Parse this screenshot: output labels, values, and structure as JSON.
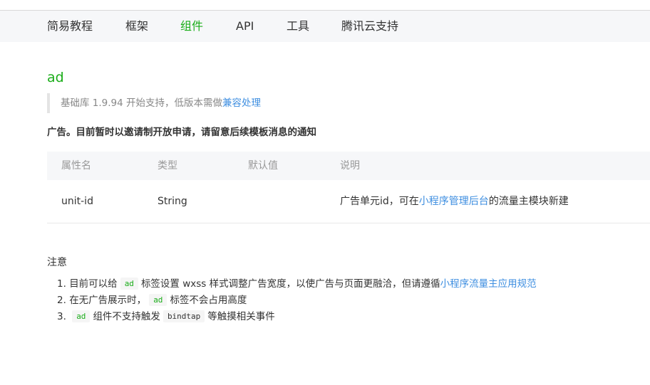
{
  "nav": {
    "items": [
      {
        "label": "简易教程",
        "active": false
      },
      {
        "label": "框架",
        "active": false
      },
      {
        "label": "组件",
        "active": true
      },
      {
        "label": "API",
        "active": false
      },
      {
        "label": "工具",
        "active": false
      },
      {
        "label": "腾讯云支持",
        "active": false
      }
    ],
    "active_color": "#1aad19"
  },
  "page": {
    "title": "ad",
    "support_text": "基础库 1.9.94 开始支持，低版本需做",
    "support_link": "兼容处理",
    "description": "广告。目前暂时以邀请制开放申请，请留意后续模板消息的通知"
  },
  "table": {
    "headers": [
      "属性名",
      "类型",
      "默认值",
      "说明"
    ],
    "rows": [
      {
        "name": "unit-id",
        "type": "String",
        "default": "",
        "desc_prefix": "广告单元id，可在",
        "desc_link": "小程序管理后台",
        "desc_suffix": "的流量主模块新建"
      }
    ]
  },
  "notes": {
    "title": "注意",
    "items": [
      {
        "num": "1.",
        "pre": "目前可以给",
        "code": "ad",
        "mid": "标签设置 wxss 样式调整广告宽度，以使广告与页面更融洽，但请遵循",
        "link": "小程序流量主应用规范"
      },
      {
        "num": "2.",
        "pre": "在无广告展示时，",
        "code": "ad",
        "post": "标签不会占用高度"
      },
      {
        "num": "3.",
        "code": "ad",
        "mid": "组件不支持触发",
        "code2": "bindtap",
        "post": "等触摸相关事件"
      }
    ]
  }
}
